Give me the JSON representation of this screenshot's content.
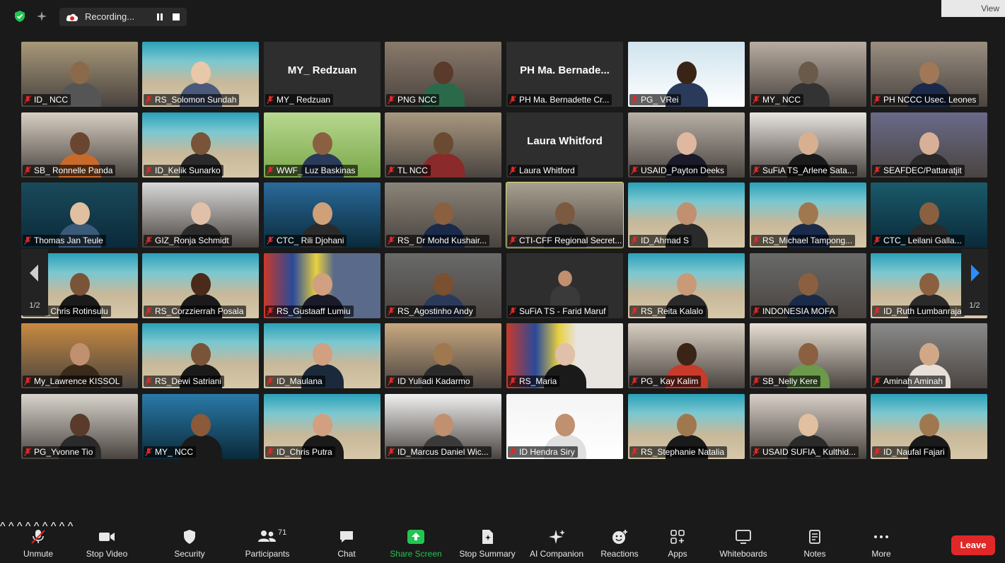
{
  "recording": {
    "label": "Recording..."
  },
  "view_button": {
    "label": "View"
  },
  "tiles": [
    {
      "name": "ID_ NCC",
      "kind": "room",
      "bg": "#a89878",
      "skin": "#8a6a4a",
      "shirt": "#555"
    },
    {
      "name": "RS_Solomon Sundah",
      "kind": "beach",
      "bg": "#c8b89a",
      "skin": "#e8c8a8",
      "shirt": "#4a5a7a"
    },
    {
      "name": "MY_ Redzuan",
      "big": "MY_ Redzuan",
      "kind": "blank",
      "bg": "#2e2e2e"
    },
    {
      "name": "PNG NCC",
      "kind": "room",
      "bg": "#8a7a6a",
      "skin": "#5a3a2a",
      "shirt": "#2a6a4a"
    },
    {
      "name": "PH Ma. Bernadette Cr...",
      "big": "PH Ma. Bernade...",
      "kind": "blank",
      "bg": "#2e2e2e"
    },
    {
      "name": "PG_ VRei",
      "kind": "slide",
      "bg": "#cfe3ee",
      "skin": "#3a2418",
      "shirt": "#2a3a5a"
    },
    {
      "name": "MY_ NCC",
      "kind": "room",
      "bg": "#b8aca0",
      "skin": "#6a5a4a",
      "shirt": "#333"
    },
    {
      "name": "PH NCCC Usec. Leones",
      "kind": "room",
      "bg": "#9a8e80",
      "skin": "#a07858",
      "shirt": "#1a2a4a"
    },
    {
      "name": "SB_ Ronnelle Panda",
      "kind": "room",
      "bg": "#d8cfc2",
      "skin": "#6a4630",
      "shirt": "#c86a2a"
    },
    {
      "name": "ID_Kelik Sunarko",
      "kind": "beach",
      "bg": "#c8b89a",
      "skin": "#7a5438",
      "shirt": "#2a2a2a"
    },
    {
      "name": "WWF_ Luz Baskinas",
      "kind": "nature",
      "bg": "#7aa84a",
      "skin": "#8a6040",
      "shirt": "#2a3a5a"
    },
    {
      "name": "TL NCC",
      "kind": "room",
      "bg": "#a89880",
      "skin": "#6a4a30",
      "shirt": "#8a2a2a"
    },
    {
      "name": "Laura Whitford",
      "big": "Laura Whitford",
      "kind": "blank",
      "bg": "#2e2e2e"
    },
    {
      "name": "USAID_Payton Deeks",
      "kind": "room",
      "bg": "#b8b0a6",
      "skin": "#e0b8a0",
      "shirt": "#1a1a2a"
    },
    {
      "name": "SuFiA TS_Arlene Sata...",
      "kind": "room",
      "bg": "#e8e4de",
      "skin": "#d8b090",
      "shirt": "#1a1a1a"
    },
    {
      "name": "SEAFDEC/Pattaratjit",
      "kind": "room",
      "bg": "#6a6a8a",
      "skin": "#d8b098",
      "shirt": "#2a2a2a"
    },
    {
      "name": "Thomas Jan Teule",
      "kind": "ocean",
      "bg": "#1a4a5a",
      "skin": "#e0c0a0",
      "shirt": "#3a5a7a"
    },
    {
      "name": "GIZ_Ronja Schmidt",
      "kind": "room",
      "bg": "#d8d8d8",
      "skin": "#e0c0a8",
      "shirt": "#2a2a2a"
    },
    {
      "name": "CTC_ Rili Djohani",
      "kind": "ocean",
      "bg": "#2a6a9a",
      "skin": "#d0a078",
      "shirt": "#2a2a2a"
    },
    {
      "name": "RS_ Dr Mohd Kushair...",
      "kind": "room",
      "bg": "#8a8478",
      "skin": "#8a6040",
      "shirt": "#1a2a4a"
    },
    {
      "name": "CTI-CFF Regional Secret...",
      "kind": "room",
      "bg": "#a8a090",
      "skin": "#7a5a40",
      "shirt": "#2a2a2a",
      "active": true
    },
    {
      "name": "ID_Ahmad S",
      "kind": "beach",
      "bg": "#c8b89a",
      "skin": "#c09070",
      "shirt": "#2a2a2a"
    },
    {
      "name": "RS_Michael Tampong...",
      "kind": "beach",
      "bg": "#c8b89a",
      "skin": "#a07850",
      "shirt": "#1a2a4a"
    },
    {
      "name": "CTC_ Leilani Galla...",
      "kind": "ocean",
      "bg": "#1a5a6a",
      "skin": "#8a6040",
      "shirt": "#2a2a2a"
    },
    {
      "name": "RS_Chris Rotinsulu",
      "kind": "beach",
      "bg": "#c8b89a",
      "skin": "#7a5438",
      "shirt": "#1a1a1a"
    },
    {
      "name": "RS_Corzzierrah Posala",
      "kind": "beach",
      "bg": "#c8b89a",
      "skin": "#4a2a1a",
      "shirt": "#1a1a1a"
    },
    {
      "name": "RS_Gustaaff Lumiu",
      "kind": "flags",
      "bg": "#5a6a8a",
      "skin": "#d0a080",
      "shirt": "#1a1a2a"
    },
    {
      "name": "RS_Agostinho Andy",
      "kind": "room",
      "bg": "#6a6a6a",
      "skin": "#7a5030",
      "shirt": "#2a3a5a"
    },
    {
      "name": "SuFiA TS - Farid Maruf",
      "kind": "blank",
      "bg": "#2e2e2e",
      "skin": "#c09070",
      "shirt": "#3a3a3a",
      "small": true
    },
    {
      "name": "RS_Reita Kalalo",
      "kind": "beach",
      "bg": "#c8b89a",
      "skin": "#c89a78",
      "shirt": "#2a2a2a"
    },
    {
      "name": "INDONESIA MOFA",
      "kind": "room",
      "bg": "#6a6a6a",
      "skin": "#8a6040",
      "shirt": "#1a2a4a"
    },
    {
      "name": "ID_Ruth Lumbanraja",
      "kind": "beach",
      "bg": "#c8b89a",
      "skin": "#8a6040",
      "shirt": "#2a2a2a"
    },
    {
      "name": "My_Lawrence KISSOL",
      "kind": "room",
      "bg": "#c88a40",
      "skin": "#c09070",
      "shirt": "#3a2a1a"
    },
    {
      "name": "RS_Dewi Satriani",
      "kind": "beach",
      "bg": "#c8b89a",
      "skin": "#7a5438",
      "shirt": "#1a1a1a"
    },
    {
      "name": "ID_Maulana",
      "kind": "beach",
      "bg": "#c8b89a",
      "skin": "#d0a080",
      "shirt": "#1a2a3a"
    },
    {
      "name": "ID Yuliadi Kadarmo",
      "kind": "room",
      "bg": "#c8a880",
      "skin": "#a07850",
      "shirt": "#2a2a2a"
    },
    {
      "name": "RS_Maria",
      "kind": "flags",
      "bg": "#e8e4e0",
      "skin": "#e0c0a8",
      "shirt": "#1a1a1a"
    },
    {
      "name": "PG_ Kay Kalim",
      "kind": "room",
      "bg": "#d8cfc2",
      "skin": "#3a2418",
      "shirt": "#c83a2a"
    },
    {
      "name": "SB_Nelly Kere",
      "kind": "room",
      "bg": "#e8e0d4",
      "skin": "#8a6040",
      "shirt": "#6a9a4a"
    },
    {
      "name": "Aminah Aminah",
      "kind": "room",
      "bg": "#8a8a8a",
      "skin": "#d0a888",
      "shirt": "#e8e0d8"
    },
    {
      "name": "PG_Yvonne Tio",
      "kind": "room",
      "bg": "#d8d4cc",
      "skin": "#5a3a2a",
      "shirt": "#2a2a2a"
    },
    {
      "name": "MY_ NCC",
      "kind": "ocean",
      "bg": "#2a7aa8",
      "skin": "#8a5a3a",
      "shirt": "#1a1a1a"
    },
    {
      "name": "ID_Chris Putra",
      "kind": "beach",
      "bg": "#c8b89a",
      "skin": "#d0a080",
      "shirt": "#1a1a1a"
    },
    {
      "name": "ID_Marcus Daniel Wic...",
      "kind": "room",
      "bg": "#f0f0f0",
      "skin": "#c09070",
      "shirt": "#3a3a3a"
    },
    {
      "name": "ID Hendra Siry",
      "kind": "slide",
      "bg": "#f4f4f4",
      "skin": "#c09070",
      "shirt": "#e0e0e0"
    },
    {
      "name": "RS_Stephanie Natalia",
      "kind": "beach",
      "bg": "#c8b89a",
      "skin": "#a07850",
      "shirt": "#1a1a1a"
    },
    {
      "name": "USAID SUFIA_ Kulthid...",
      "kind": "room",
      "bg": "#d8d0c8",
      "skin": "#e0c0a0",
      "shirt": "#2a2a2a"
    },
    {
      "name": "ID_Naufal Fajari",
      "kind": "beach",
      "bg": "#c8b89a",
      "skin": "#a07850",
      "shirt": "#1a1a1a"
    }
  ],
  "pager": {
    "page": "1/2"
  },
  "toolbar": {
    "unmute": "Unmute",
    "stop_video": "Stop Video",
    "security": "Security",
    "participants": "Participants",
    "participants_count": "71",
    "chat": "Chat",
    "share_screen": "Share Screen",
    "stop_summary": "Stop Summary",
    "ai_companion": "AI Companion",
    "reactions": "Reactions",
    "apps": "Apps",
    "whiteboards": "Whiteboards",
    "notes": "Notes",
    "more": "More",
    "leave": "Leave"
  },
  "colors": {
    "share_green": "#23c552",
    "leave_red": "#e02828",
    "active_outline": "#d9e36a",
    "mute_red": "#e02828"
  }
}
